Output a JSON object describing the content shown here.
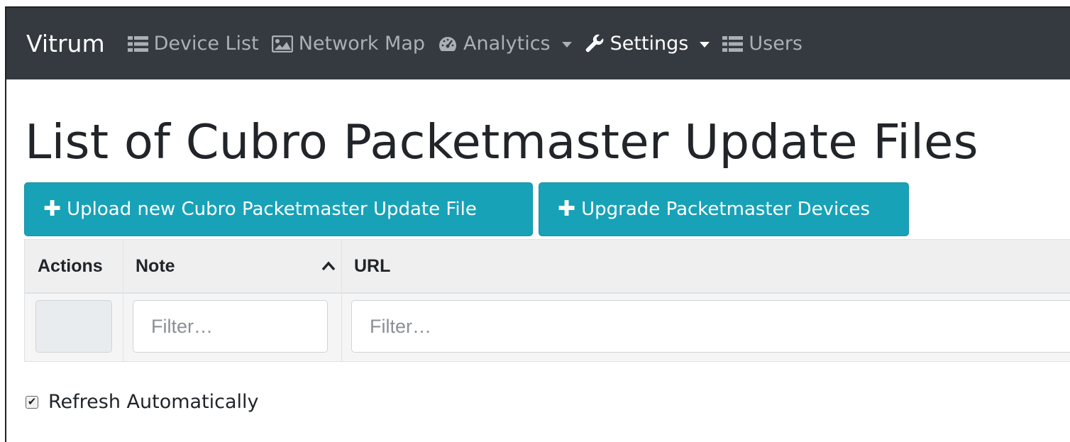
{
  "navbar": {
    "brand": "Vitrum",
    "items": [
      {
        "label": "Device List",
        "icon": "list-icon"
      },
      {
        "label": "Network Map",
        "icon": "image-icon"
      },
      {
        "label": "Analytics",
        "icon": "dashboard-icon",
        "dropdown": true
      },
      {
        "label": "Settings",
        "icon": "wrench-icon",
        "dropdown": true,
        "active": true
      },
      {
        "label": "Users",
        "icon": "list-icon"
      }
    ]
  },
  "page": {
    "title": "List of Cubro Packetmaster Update Files"
  },
  "buttons": {
    "upload_label": "Upload new Cubro Packetmaster Update File",
    "upgrade_label": "Upgrade Packetmaster Devices"
  },
  "table": {
    "columns": [
      "Actions",
      "Note",
      "URL"
    ],
    "sorted_column": "Note",
    "sort_direction": "ascending",
    "filter_placeholder": "Filter…"
  },
  "refresh": {
    "label": "Refresh Automatically",
    "checked": true
  },
  "colors": {
    "navbar_bg": "#343a40",
    "button_bg": "#17a2b8"
  }
}
